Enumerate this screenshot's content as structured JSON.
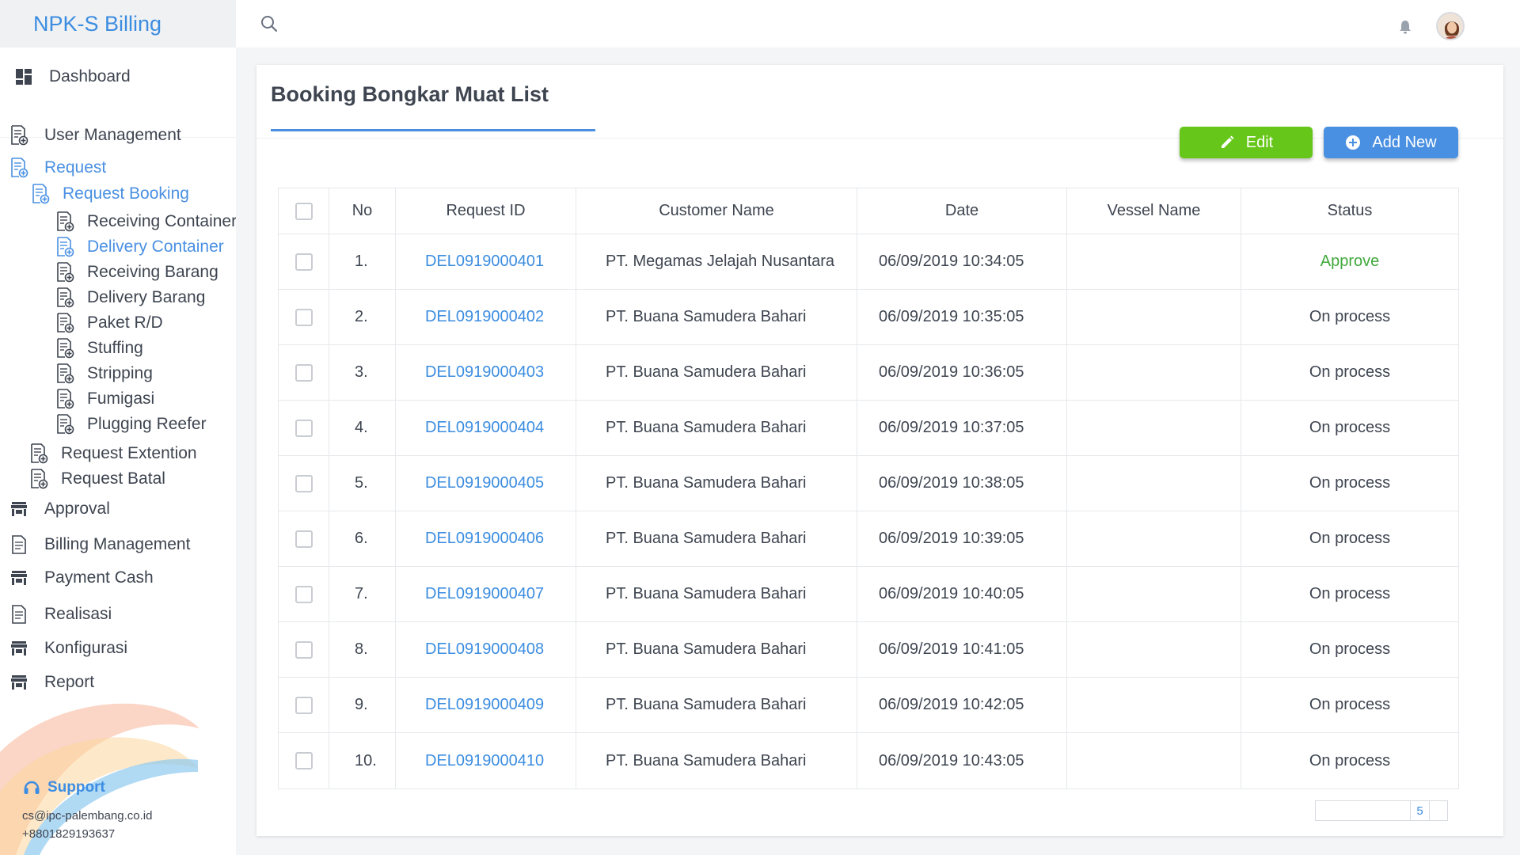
{
  "app": {
    "title": "NPK-S Billing"
  },
  "colors": {
    "accent": "#4a90e2",
    "edit": "#67c61a",
    "approve": "#40a93c"
  },
  "sidebar": {
    "items": [
      {
        "label": "Dashboard",
        "icon": "dashboard-icon"
      },
      {
        "label": "User Management",
        "icon": "document-plus-icon"
      },
      {
        "label": "Request",
        "icon": "document-plus-icon",
        "active": true
      },
      {
        "label": "Request Booking",
        "icon": "document-plus-icon",
        "active": true
      },
      {
        "label": "Receiving Container",
        "icon": "document-plus-icon"
      },
      {
        "label": "Delivery Container",
        "icon": "document-plus-icon",
        "active": true
      },
      {
        "label": "Receiving Barang",
        "icon": "document-plus-icon"
      },
      {
        "label": "Delivery Barang",
        "icon": "document-plus-icon"
      },
      {
        "label": "Paket R/D",
        "icon": "document-plus-icon"
      },
      {
        "label": "Stuffing",
        "icon": "document-plus-icon"
      },
      {
        "label": "Stripping",
        "icon": "document-plus-icon"
      },
      {
        "label": "Fumigasi",
        "icon": "document-plus-icon"
      },
      {
        "label": "Plugging Reefer",
        "icon": "document-plus-icon"
      },
      {
        "label": "Request Extention",
        "icon": "document-plus-icon"
      },
      {
        "label": "Request Batal",
        "icon": "document-plus-icon"
      },
      {
        "label": "Approval",
        "icon": "store-icon"
      },
      {
        "label": "Billing Management",
        "icon": "document-icon"
      },
      {
        "label": "Payment Cash",
        "icon": "store-icon"
      },
      {
        "label": "Realisasi",
        "icon": "document-icon"
      },
      {
        "label": "Konfigurasi",
        "icon": "store-icon"
      },
      {
        "label": "Report",
        "icon": "store-icon"
      }
    ],
    "support": {
      "label": "Support",
      "email": "cs@ipc-palembang.co.id",
      "phone": "+8801829193637"
    }
  },
  "main": {
    "title": "Booking Bongkar Muat List",
    "buttons": {
      "edit": "Edit",
      "add_new": "Add New"
    },
    "table": {
      "headers": [
        "No",
        "Request ID",
        "Customer Name",
        "Date",
        "Vessel Name",
        "Status"
      ],
      "rows": [
        {
          "no": "1.",
          "id": "DEL0919000401",
          "customer": "PT. Megamas Jelajah Nusantara",
          "date": "06/09/2019 10:34:05",
          "vessel": "",
          "status": "Approve"
        },
        {
          "no": "2.",
          "id": "DEL0919000402",
          "customer": "PT. Buana Samudera Bahari",
          "date": "06/09/2019 10:35:05",
          "vessel": "",
          "status": "On process"
        },
        {
          "no": "3.",
          "id": "DEL0919000403",
          "customer": "PT. Buana Samudera Bahari",
          "date": "06/09/2019 10:36:05",
          "vessel": "",
          "status": "On process"
        },
        {
          "no": "4.",
          "id": "DEL0919000404",
          "customer": "PT. Buana Samudera Bahari",
          "date": "06/09/2019 10:37:05",
          "vessel": "",
          "status": "On process"
        },
        {
          "no": "5.",
          "id": "DEL0919000405",
          "customer": "PT. Buana Samudera Bahari",
          "date": "06/09/2019 10:38:05",
          "vessel": "",
          "status": "On process"
        },
        {
          "no": "6.",
          "id": "DEL0919000406",
          "customer": "PT. Buana Samudera Bahari",
          "date": "06/09/2019 10:39:05",
          "vessel": "",
          "status": "On process"
        },
        {
          "no": "7.",
          "id": "DEL0919000407",
          "customer": "PT. Buana Samudera Bahari",
          "date": "06/09/2019 10:40:05",
          "vessel": "",
          "status": "On process"
        },
        {
          "no": "8.",
          "id": "DEL0919000408",
          "customer": "PT. Buana Samudera Bahari",
          "date": "06/09/2019 10:41:05",
          "vessel": "",
          "status": "On process"
        },
        {
          "no": "9.",
          "id": "DEL0919000409",
          "customer": "PT. Buana Samudera Bahari",
          "date": "06/09/2019 10:42:05",
          "vessel": "",
          "status": "On process"
        },
        {
          "no": "10.",
          "id": "DEL0919000410",
          "customer": "PT. Buana Samudera Bahari",
          "date": "06/09/2019 10:43:05",
          "vessel": "",
          "status": "On process"
        }
      ]
    },
    "pagination": {
      "page": "5"
    }
  }
}
